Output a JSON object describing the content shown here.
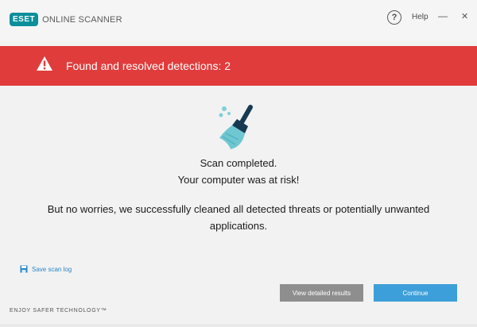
{
  "titlebar": {
    "brand_badge": "ESET",
    "product_name": "ONLINE SCANNER",
    "help_icon_glyph": "?",
    "help_label": "Help",
    "minimize_glyph": "—",
    "close_glyph": "✕"
  },
  "alert": {
    "text": "Found and resolved detections: 2",
    "color": "#e03c3c",
    "icon": "warning-triangle-icon"
  },
  "main": {
    "illustration_icon": "broom-icon",
    "line1": "Scan completed.",
    "line2": "Your computer was at risk!",
    "line3": "But no worries, we successfully cleaned all detected threats or potentially unwanted",
    "line4": "applications."
  },
  "footer": {
    "save_log_label": "Save scan log",
    "save_log_icon": "save-icon",
    "tagline": "ENJOY SAFER TECHNOLOGY™",
    "details_button": "View detailed results",
    "continue_button": "Continue",
    "continue_color": "#3d9fd9"
  }
}
